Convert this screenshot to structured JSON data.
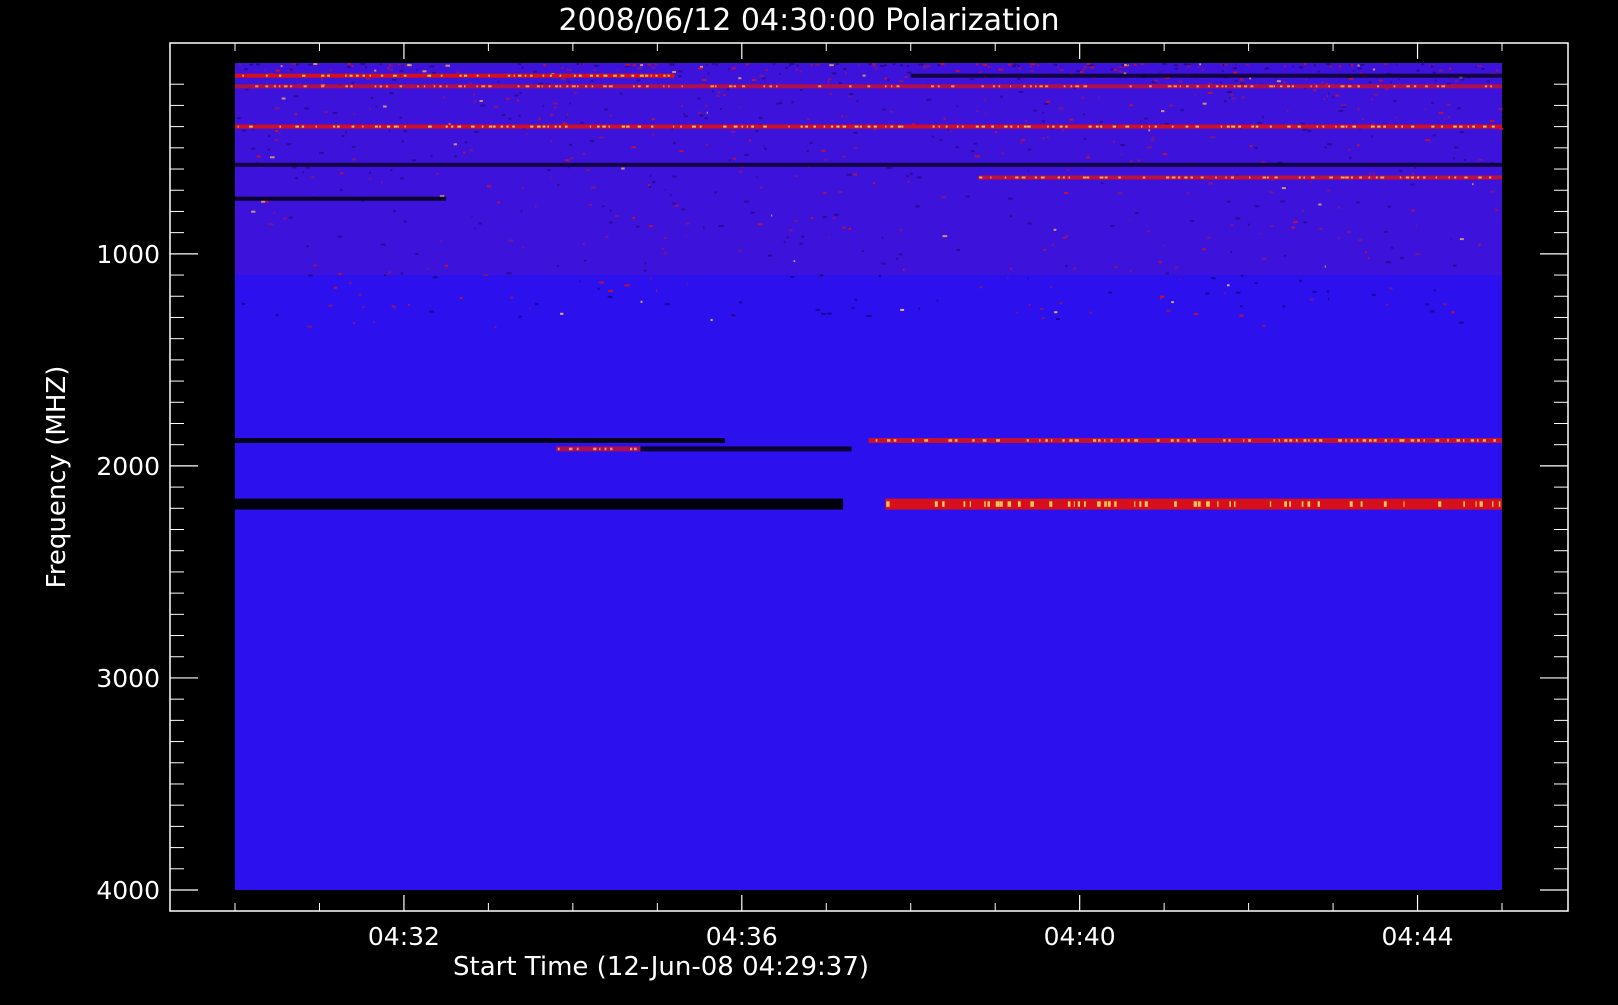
{
  "chart_data": {
    "type": "heatmap",
    "title": "2008/06/12 04:30:00 Polarization",
    "xlabel": "Start Time (12-Jun-08 04:29:37)",
    "ylabel": "Frequency (MHZ)",
    "x_ticks": [
      "04:32",
      "04:36",
      "04:40",
      "04:44"
    ],
    "x_tick_minutes": [
      32,
      36,
      40,
      44
    ],
    "x_range_minutes": [
      30,
      45
    ],
    "y_ticks": [
      "1000",
      "2000",
      "3000",
      "4000"
    ],
    "y_tick_values": [
      1000,
      2000,
      3000,
      4000
    ],
    "y_range": [
      100,
      4000
    ],
    "y_inverted": true,
    "grid": false,
    "colors": {
      "background": "#000000",
      "base": "#2c10ee",
      "low": "#000000",
      "mid": "#e01010",
      "high": "#ffd060",
      "axis": "#ffffff"
    },
    "features": [
      {
        "kind": "bright",
        "freq": 160,
        "t0": 30,
        "t1": 35.2,
        "intensity": 0.95
      },
      {
        "kind": "bright",
        "freq": 210,
        "t0": 30,
        "t1": 45,
        "intensity": 0.7
      },
      {
        "kind": "dark",
        "freq": 160,
        "t0": 38,
        "t1": 45,
        "intensity": 0.7
      },
      {
        "kind": "bright",
        "freq": 400,
        "t0": 30,
        "t1": 45,
        "intensity": 0.9
      },
      {
        "kind": "dark",
        "freq": 580,
        "t0": 30,
        "t1": 45,
        "intensity": 0.7
      },
      {
        "kind": "bright",
        "freq": 640,
        "t0": 38.8,
        "t1": 45,
        "intensity": 0.8
      },
      {
        "kind": "dark",
        "freq": 740,
        "t0": 30,
        "t1": 32.5,
        "intensity": 0.8
      },
      {
        "kind": "dark",
        "freq": 1880,
        "t0": 30,
        "t1": 35.8,
        "intensity": 0.9
      },
      {
        "kind": "bright",
        "freq": 1880,
        "t0": 37.5,
        "t1": 45,
        "intensity": 0.85
      },
      {
        "kind": "bright",
        "freq": 1920,
        "t0": 33.8,
        "t1": 34.8,
        "intensity": 0.7
      },
      {
        "kind": "dark",
        "freq": 1920,
        "t0": 34.8,
        "t1": 37.3,
        "intensity": 0.8
      },
      {
        "kind": "dark",
        "freq": 2180,
        "t0": 30,
        "t1": 37.2,
        "intensity": 0.95
      },
      {
        "kind": "bright",
        "freq": 2180,
        "t0": 37.7,
        "t1": 45,
        "intensity": 0.95
      }
    ]
  }
}
